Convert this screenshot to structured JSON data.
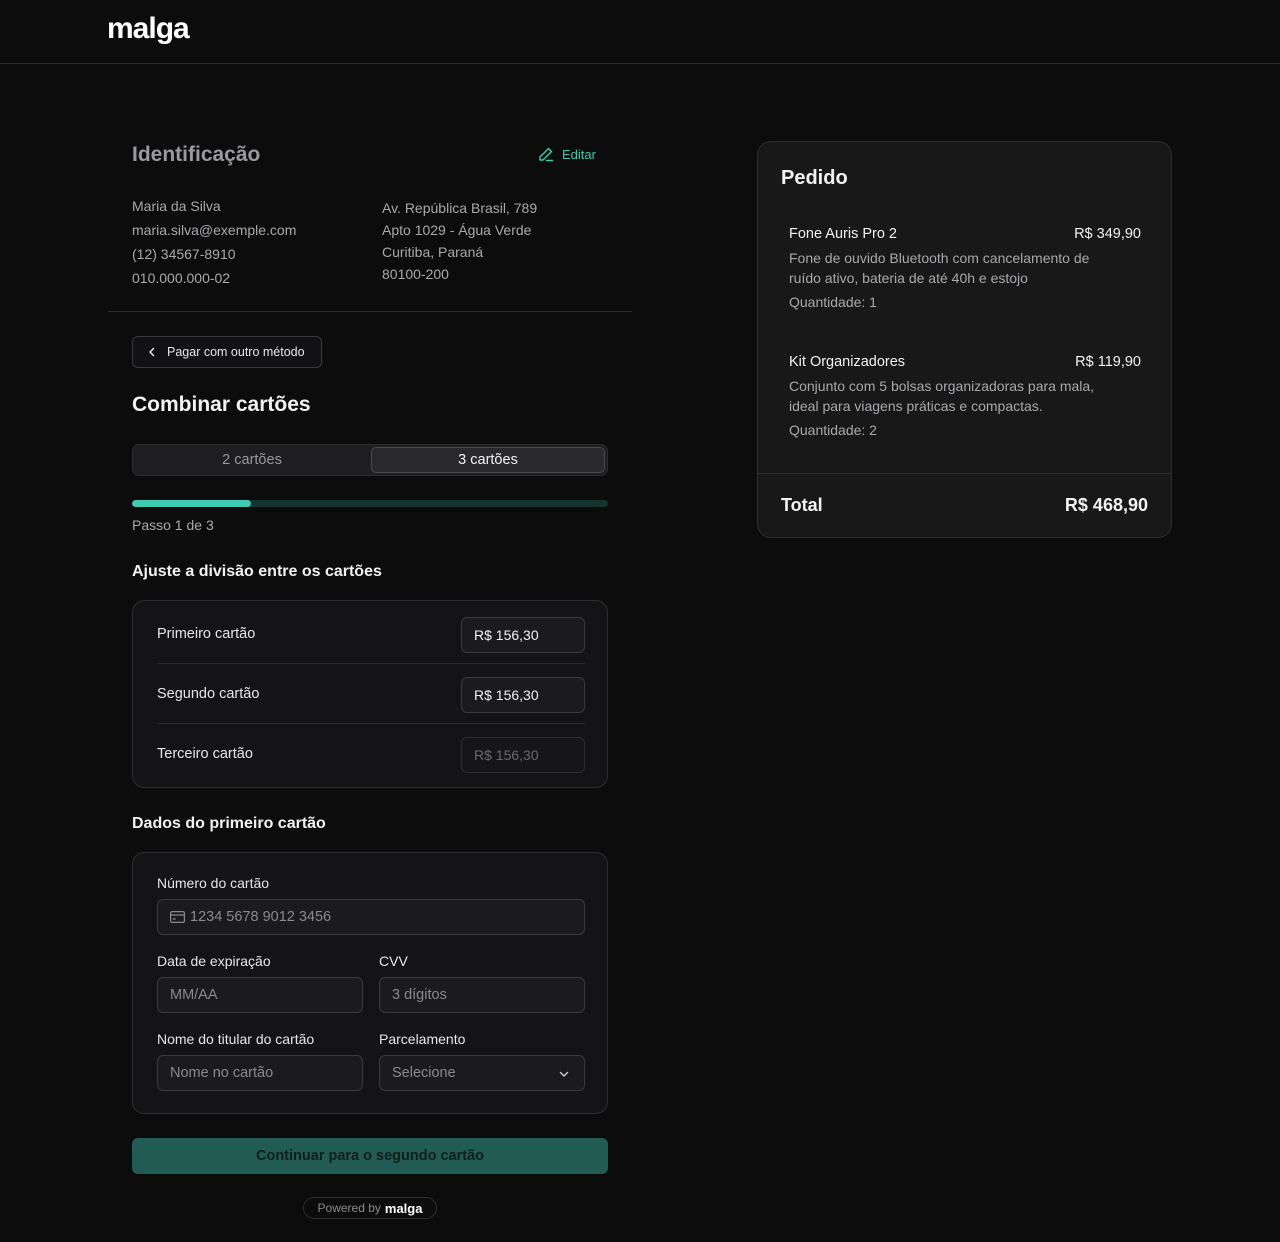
{
  "header": {
    "logo": "malga"
  },
  "identification": {
    "title": "Identificação",
    "edit_label": "Editar",
    "name": "Maria da Silva",
    "email": "maria.silva@exemple.com",
    "phone": "(12) 34567-8910",
    "document": "010.000.000-02",
    "address_line1": "Av. República Brasil, 789",
    "address_line2": "Apto 1029 - Água Verde",
    "city_state": "Curitiba, Paraná",
    "zip": "80100-200"
  },
  "other_method_label": "Pagar com outro método",
  "combine": {
    "title": "Combinar cartões",
    "options": [
      "2 cartões",
      "3 cartões"
    ],
    "selected_option": "3 cartões",
    "progress": {
      "current_step": 1,
      "total_steps": 3,
      "fraction": 0.25
    },
    "step_text": "Passo 1 de 3"
  },
  "split": {
    "title": "Ajuste a divisão entre os cartões",
    "rows": [
      {
        "label": "Primeiro cartão",
        "value": "R$ 156,30",
        "enabled": true
      },
      {
        "label": "Segundo cartão",
        "value": "R$ 156,30",
        "enabled": true
      },
      {
        "label": "Terceiro cartão",
        "value": "R$ 156,30",
        "enabled": false
      }
    ]
  },
  "card_form": {
    "title": "Dados do primeiro cartão",
    "number_label": "Número do cartão",
    "number_placeholder": "1234 5678 9012 3456",
    "expiry_label": "Data de expiração",
    "expiry_placeholder": "MM/AA",
    "cvv_label": "CVV",
    "cvv_placeholder": "3 dígitos",
    "holder_label": "Nome do titular do cartão",
    "holder_placeholder": "Nome no cartão",
    "installments_label": "Parcelamento",
    "installments_value": "Selecione"
  },
  "continue_label": "Continuar para o segundo cartão",
  "powered": {
    "prefix": "Powered by",
    "brand": "malga"
  },
  "order": {
    "title": "Pedido",
    "items": [
      {
        "name": "Fone Auris Pro 2",
        "price": "R$ 349,90",
        "description": "Fone de ouvido Bluetooth com cancelamento de ruído ativo, bateria de até 40h e estojo",
        "quantity": "Quantidade: 1"
      },
      {
        "name": "Kit Organizadores",
        "price": "R$ 119,90",
        "description": "Conjunto com 5 bolsas organizadoras para mala, ideal para viagens práticas e compactas.",
        "quantity": "Quantidade: 2"
      }
    ],
    "total_label": "Total",
    "total_value": "R$ 468,90"
  },
  "colors": {
    "accent": "#3ec9b1",
    "button_bg": "#225b54",
    "background": "#0c0c0d"
  },
  "icons": {
    "edit": "pencil-icon",
    "back": "chevron-left-icon",
    "card": "credit-card-icon",
    "select": "chevron-down-icon"
  }
}
